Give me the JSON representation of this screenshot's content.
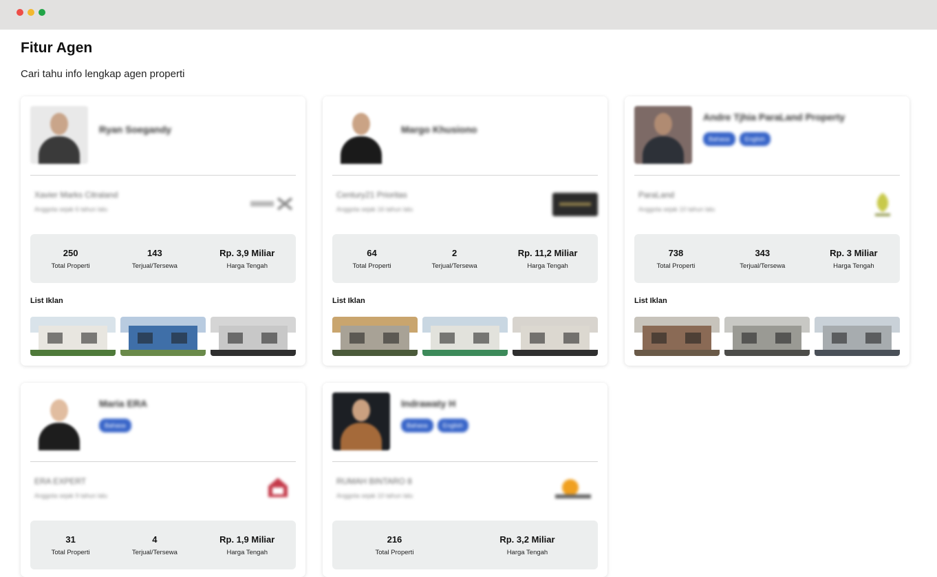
{
  "window": {
    "controls": [
      "close",
      "minimize",
      "maximize"
    ]
  },
  "header": {
    "title": "Fitur Agen",
    "subtitle": "Cari tahu info lengkap agen properti"
  },
  "cards": [
    {
      "name": "Ryan Soegandy",
      "badges": [],
      "office": "Xavier Marks Citraland",
      "joined": "Anggota sejak 6 tahun lalu",
      "stats": [
        {
          "value": "250",
          "label": "Total Properti"
        },
        {
          "value": "143",
          "label": "Terjual/Tersewa"
        },
        {
          "value": "Rp. 3,9 Miliar",
          "label": "Harga Tengah"
        }
      ],
      "list_label": "List Iklan",
      "colors": {
        "avatar_bg": "#e9e9e9",
        "suit": "#3a3a3a",
        "face": "#c9a58a",
        "logo": "#8a8a8a"
      },
      "thumbs": [
        {
          "sky": "#d9e3ea",
          "wall": "#e8e6e0",
          "accent": "#4f7a3a"
        },
        {
          "sky": "#b8cbe0",
          "wall": "#3f6fa8",
          "accent": "#6a8a4a"
        },
        {
          "sky": "#d5d5d5",
          "wall": "#c8c8c8",
          "accent": "#2f2f2f"
        }
      ]
    },
    {
      "name": "Margo Khusiono",
      "badges": [],
      "office": "Century21 Prioritas",
      "joined": "Anggota sejak 16 tahun lalu",
      "stats": [
        {
          "value": "64",
          "label": "Total Properti"
        },
        {
          "value": "2",
          "label": "Terjual/Tersewa"
        },
        {
          "value": "Rp. 11,2 Miliar",
          "label": "Harga Tengah"
        }
      ],
      "list_label": "List Iklan",
      "colors": {
        "avatar_bg": "#ffffff",
        "suit": "#1a1a1a",
        "face": "#caa385",
        "logo": "#2b2b2b"
      },
      "thumbs": [
        {
          "sky": "#c9a56e",
          "wall": "#a8a296",
          "accent": "#4b5a3a"
        },
        {
          "sky": "#c9d7e2",
          "wall": "#e2e2dc",
          "accent": "#3d8a5a"
        },
        {
          "sky": "#d8d4ce",
          "wall": "#dcd8d0",
          "accent": "#2f2f2f"
        }
      ]
    },
    {
      "name": "Andre Tjhia ParaLand Property",
      "badges": [
        "Bahasa",
        "English"
      ],
      "office": "ParaLand",
      "joined": "Anggota sejak 10 tahun lalu",
      "stats": [
        {
          "value": "738",
          "label": "Total Properti"
        },
        {
          "value": "343",
          "label": "Terjual/Tersewa"
        },
        {
          "value": "Rp. 3 Miliar",
          "label": "Harga Tengah"
        }
      ],
      "list_label": "List Iklan",
      "colors": {
        "avatar_bg": "#7d6a66",
        "suit": "#2d3138",
        "face": "#b08b72",
        "logo": "#c8c94a"
      },
      "thumbs": [
        {
          "sky": "#c7c3bb",
          "wall": "#8a6a55",
          "accent": "#6a5a48"
        },
        {
          "sky": "#c8c8c4",
          "wall": "#9a9a94",
          "accent": "#4d4d4a"
        },
        {
          "sky": "#c9d1d8",
          "wall": "#a7acaf",
          "accent": "#4a5058"
        }
      ]
    },
    {
      "name": "Maria ERA",
      "badges": [
        "Bahasa"
      ],
      "office": "ERA EXPERT",
      "joined": "Anggota sejak 9 tahun lalu",
      "stats": [
        {
          "value": "31",
          "label": "Total Properti"
        },
        {
          "value": "4",
          "label": "Terjual/Tersewa"
        },
        {
          "value": "Rp. 1,9 Miliar",
          "label": "Harga Tengah"
        }
      ],
      "colors": {
        "avatar_bg": "#ffffff",
        "suit": "#1d1d1d",
        "face": "#e1bda0",
        "logo": "#c43a4a"
      }
    },
    {
      "name": "Indrawaty H",
      "badges": [
        "Bahasa",
        "English"
      ],
      "office": "RUMAH BINTARO 8",
      "joined": "Anggota sejak 10 tahun lalu",
      "stats": [
        {
          "value": "216",
          "label": "Total Properti"
        },
        {
          "value": "Rp. 3,2 Miliar",
          "label": "Harga Tengah"
        }
      ],
      "colors": {
        "avatar_bg": "#1c1f24",
        "suit": "#a56a3a",
        "face": "#caa080",
        "logo": "#f0a020"
      }
    }
  ]
}
